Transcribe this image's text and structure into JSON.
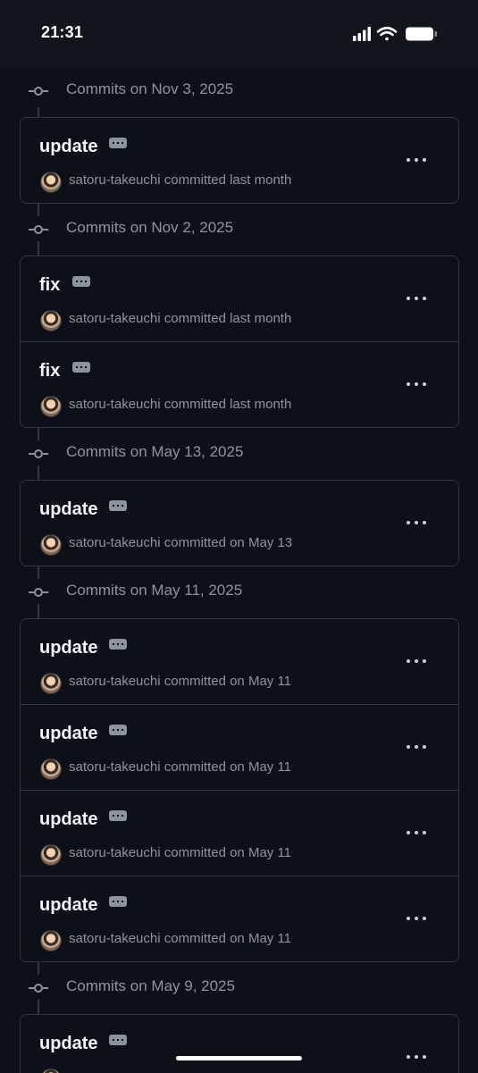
{
  "status_bar": {
    "time": "21:31"
  },
  "days": [
    {
      "label": "Commits on Nov 3, 2025",
      "commits": [
        {
          "message": "update",
          "author": "satoru-takeuchi",
          "action": "committed",
          "when": "last month"
        }
      ]
    },
    {
      "label": "Commits on Nov 2, 2025",
      "commits": [
        {
          "message": "fix",
          "author": "satoru-takeuchi",
          "action": "committed",
          "when": "last month"
        },
        {
          "message": "fix",
          "author": "satoru-takeuchi",
          "action": "committed",
          "when": "last month"
        }
      ]
    },
    {
      "label": "Commits on May 13, 2025",
      "commits": [
        {
          "message": "update",
          "author": "satoru-takeuchi",
          "action": "committed",
          "when": "on May 13"
        }
      ]
    },
    {
      "label": "Commits on May 11, 2025",
      "commits": [
        {
          "message": "update",
          "author": "satoru-takeuchi",
          "action": "committed",
          "when": "on May 11"
        },
        {
          "message": "update",
          "author": "satoru-takeuchi",
          "action": "committed",
          "when": "on May 11"
        },
        {
          "message": "update",
          "author": "satoru-takeuchi",
          "action": "committed",
          "when": "on May 11"
        },
        {
          "message": "update",
          "author": "satoru-takeuchi",
          "action": "committed",
          "when": "on May 11"
        }
      ]
    },
    {
      "label": "Commits on May 9, 2025",
      "commits": [
        {
          "message": "update",
          "author": "",
          "action": "",
          "when": ""
        }
      ]
    }
  ],
  "icons": {
    "signal": "cellular-signal-icon",
    "wifi": "wifi-icon",
    "battery": "battery-icon",
    "commit": "git-commit-icon",
    "more": "kebab-horizontal-icon",
    "ellipsis": "ellipsis-icon"
  },
  "colors": {
    "background": "#0d1117",
    "border": "#30363d",
    "muted_text": "#8b949e",
    "primary_text": "#f0f6fc"
  }
}
